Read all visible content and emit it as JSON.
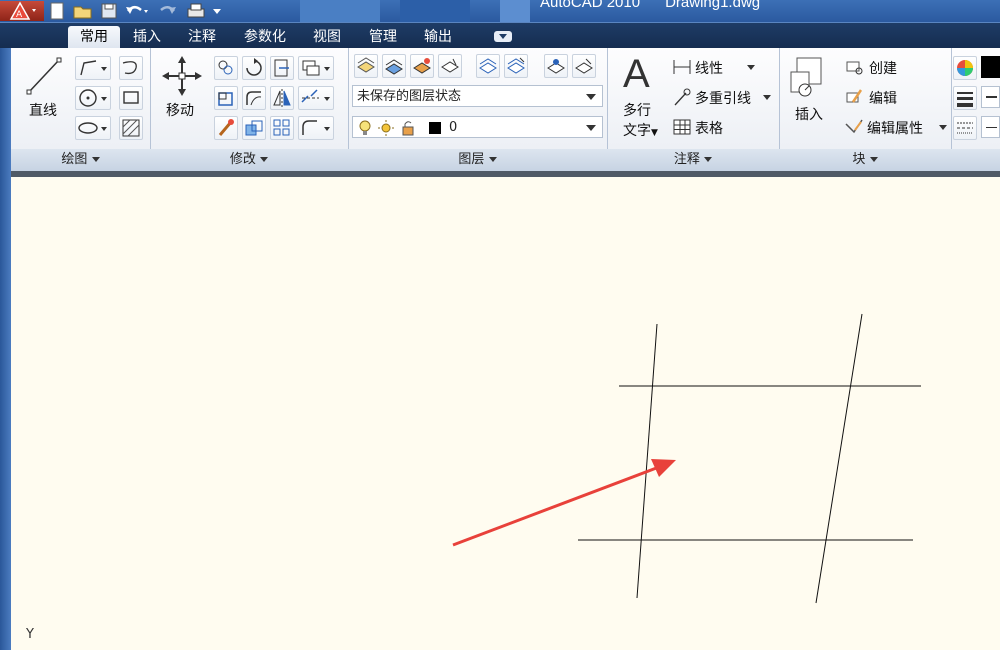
{
  "window": {
    "title": "AutoCAD 2010      Drawing1.dwg"
  },
  "quick_access": [
    "app-menu",
    "new",
    "open",
    "save",
    "undo",
    "redo",
    "plot",
    "customize"
  ],
  "tabs": [
    {
      "label": "常用",
      "active": true
    },
    {
      "label": "插入"
    },
    {
      "label": "注释"
    },
    {
      "label": "参数化"
    },
    {
      "label": "视图"
    },
    {
      "label": "管理"
    },
    {
      "label": "输出"
    }
  ],
  "panels": {
    "draw": {
      "title": "绘图",
      "line_label": "直线"
    },
    "modify": {
      "title": "修改",
      "move_label": "移动"
    },
    "layers": {
      "title": "图层",
      "layer_state": "未保存的图层状态",
      "current_layer": "0"
    },
    "annotation": {
      "title": "注释",
      "mtext_label1": "多行",
      "mtext_label2": "文字",
      "linear_label": "线性",
      "mleader_label": "多重引线",
      "table_label": "表格"
    },
    "block": {
      "title": "块",
      "insert_label": "插入",
      "create_label": "创建",
      "edit_label": "编辑",
      "edit_attr_label": "编辑属性"
    }
  },
  "colors": {
    "canvas_bg": "#fffcf0",
    "arrow": "#e8413a",
    "accent": "#2b5aa0"
  },
  "canvas": {
    "ucs_label": "Y"
  }
}
